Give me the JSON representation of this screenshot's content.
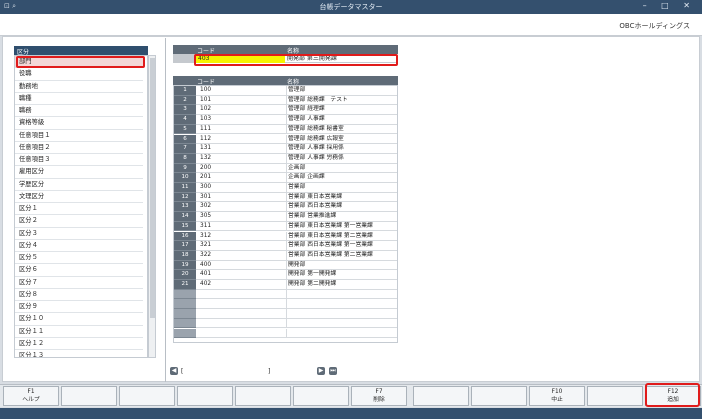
{
  "window": {
    "title": "台帳データマスター",
    "controls": "–  □  ✕"
  },
  "company": "OBCホールディングス",
  "left_panel": {
    "header": "区分",
    "items": [
      "部門",
      "役職",
      "勤務地",
      "職種",
      "職務",
      "資格等級",
      "任意項目１",
      "任意項目２",
      "任意項目３",
      "雇用区分",
      "学歴区分",
      "文理区分",
      "区分１",
      "区分２",
      "区分３",
      "区分４",
      "区分５",
      "区分６",
      "区分７",
      "区分８",
      "区分９",
      "区分１０",
      "区分１１",
      "区分１２",
      "区分１３"
    ]
  },
  "grid": {
    "col_code": "コード",
    "col_name": "名称",
    "new_entry": {
      "code": "403",
      "name": "開発部 第三開発課"
    },
    "rows": [
      {
        "no": "1",
        "code": "100",
        "name": "管理部"
      },
      {
        "no": "2",
        "code": "101",
        "name": "管理部 総務課　テスト"
      },
      {
        "no": "3",
        "code": "102",
        "name": "管理部 経理課"
      },
      {
        "no": "4",
        "code": "103",
        "name": "管理部 人事課"
      },
      {
        "no": "5",
        "code": "111",
        "name": "管理部 総務課 秘書室"
      },
      {
        "no": "6",
        "code": "112",
        "name": "管理部 総務課 広報室"
      },
      {
        "no": "7",
        "code": "131",
        "name": "管理部 人事課 採用係"
      },
      {
        "no": "8",
        "code": "132",
        "name": "管理部 人事課 労務係"
      },
      {
        "no": "9",
        "code": "200",
        "name": "企画部"
      },
      {
        "no": "10",
        "code": "201",
        "name": "企画部 企画課"
      },
      {
        "no": "11",
        "code": "300",
        "name": "営業部"
      },
      {
        "no": "12",
        "code": "301",
        "name": "営業部 東日本営業課"
      },
      {
        "no": "13",
        "code": "302",
        "name": "営業部 西日本営業課"
      },
      {
        "no": "14",
        "code": "305",
        "name": "営業部 営業推進課"
      },
      {
        "no": "15",
        "code": "311",
        "name": "営業部 東日本営業課 第一営業課"
      },
      {
        "no": "16",
        "code": "312",
        "name": "営業部 東日本営業課 第二営業課"
      },
      {
        "no": "17",
        "code": "321",
        "name": "営業部 西日本営業課 第一営業課"
      },
      {
        "no": "18",
        "code": "322",
        "name": "営業部 西日本営業課 第二営業課"
      },
      {
        "no": "19",
        "code": "400",
        "name": "開発部"
      },
      {
        "no": "20",
        "code": "401",
        "name": "開発部 第一開発課"
      },
      {
        "no": "21",
        "code": "402",
        "name": "開発部 第二開発課"
      }
    ]
  },
  "pager": {
    "left_bracket": "[",
    "right_bracket": "]",
    "prev": "◀",
    "next": "▶",
    "last": "⏭"
  },
  "fkeys": [
    {
      "key": "F1",
      "label": "ヘルプ"
    },
    {
      "key": "",
      "label": ""
    },
    {
      "key": "",
      "label": ""
    },
    {
      "key": "",
      "label": ""
    },
    {
      "key": "",
      "label": ""
    },
    {
      "key": "",
      "label": ""
    },
    {
      "key": "F7",
      "label": "削除"
    },
    {
      "key": "",
      "label": ""
    },
    {
      "key": "",
      "label": ""
    },
    {
      "key": "F10",
      "label": "中止"
    },
    {
      "key": "",
      "label": ""
    },
    {
      "key": "F12",
      "label": "追加"
    }
  ]
}
